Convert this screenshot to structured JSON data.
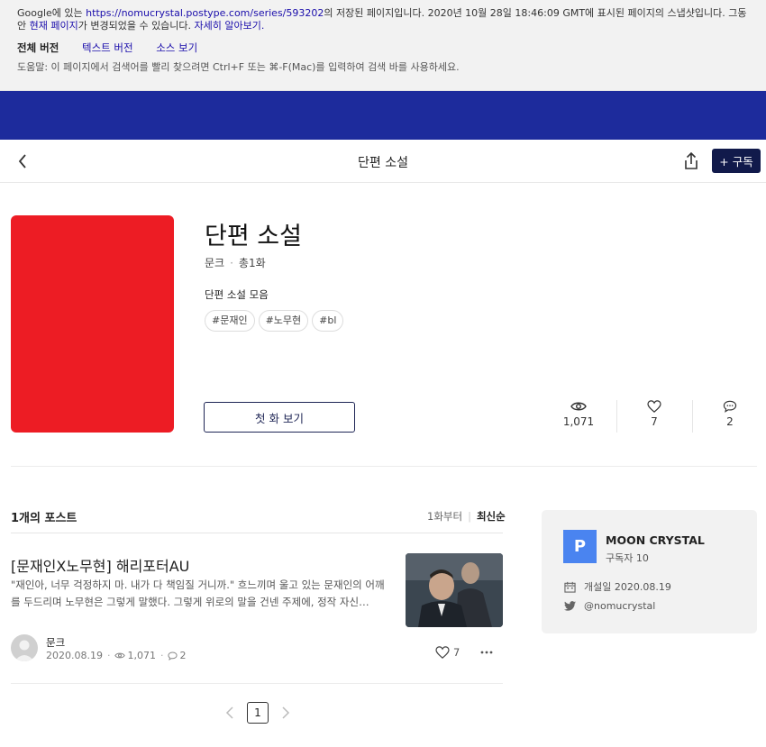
{
  "cache": {
    "notice_pre": "Google에 있는 ",
    "notice_url": "https://nomucrystal.postype.com/series/593202",
    "notice_post": "의 저장된 페이지입니다. 2020년 10월 28일 18:46:09 GMT에 표시된 페이지의 스냅샷입니다. 그동안 ",
    "notice_link1": "현재 페이지",
    "notice_mid": "가 변경되었을 수 있습니다. ",
    "notice_link2": "자세히 알아보기.",
    "tabs": [
      "전체 버전",
      "텍스트 버전",
      "소스 보기"
    ],
    "help": "도움말: 이 페이지에서 검색어를 빨리 찾으려면 Ctrl+F 또는 ⌘-F(Mac)를 입력하여 검색 바를 사용하세요."
  },
  "header": {
    "title": "단편 소설",
    "subscribe_label": "+ 구독"
  },
  "series": {
    "name": "단편 소설",
    "author": "문크",
    "episode_count": "총1화",
    "description": "단편 소설 모음",
    "tags": [
      "#문재인",
      "#노무현",
      "#bl"
    ],
    "first_button": "첫 화 보기",
    "cover_color": "#ed1c24",
    "stats": {
      "views": "1,071",
      "likes": "7",
      "comments": "2"
    }
  },
  "posts": {
    "count_label": "1개의 포스트",
    "sort_options": [
      "1화부터",
      "최신순"
    ],
    "items": [
      {
        "title": "[문재인X노무현] 해리포터AU",
        "excerpt": "\"재인아, 너무 걱정하지 마. 내가 다 책임질 거니까.\"  흐느끼며 울고 있는 문재인의 어깨를 두드리며 노무현은 그렇게 말했다. 그렇게 위로의 말을 건넨 주제에, 정작 자신…",
        "author": "문크",
        "date": "2020.08.19",
        "views": "1,071",
        "comments": "2",
        "likes": "7"
      }
    ]
  },
  "pagination": {
    "current": "1"
  },
  "channel": {
    "initial": "P",
    "name": "MOON CRYSTAL",
    "subscribers": "구독자 10",
    "opened": "개설일  2020.08.19",
    "twitter": "@nomucrystal",
    "accent": "#4a84f0"
  }
}
